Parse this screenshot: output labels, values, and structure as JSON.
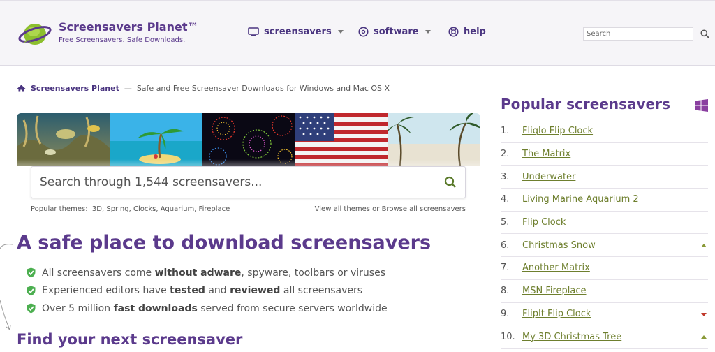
{
  "header": {
    "brand_title": "Screensavers Planet™",
    "brand_tagline": "Free Screensavers. Safe Downloads.",
    "nav": [
      {
        "label": "screensavers",
        "icon": "monitor-icon",
        "has_dropdown": true
      },
      {
        "label": "software",
        "icon": "disc-icon",
        "has_dropdown": true
      },
      {
        "label": "help",
        "icon": "lifebuoy-icon",
        "has_dropdown": false
      }
    ],
    "search_placeholder": "Search"
  },
  "breadcrumb": {
    "home": "Screensavers Planet",
    "separator": "—",
    "description": "Safe and Free Screensaver Downloads for Windows and Mac OS X"
  },
  "hero": {
    "tiles": [
      "aquarium",
      "island",
      "fireworks",
      "us-flag",
      "beach"
    ],
    "search_placeholder": "Search through 1,544 screensavers...",
    "popular_themes_label": "Popular themes:",
    "themes": [
      "3D",
      "Spring",
      "Clocks",
      "Aquarium",
      "Fireplace"
    ],
    "view_all_themes": "View all themes",
    "or_text": "or",
    "browse_all": "Browse all screensavers"
  },
  "main": {
    "heading": "A safe place to download screensavers",
    "benefits": [
      {
        "pre": "All screensavers come ",
        "bold": "without adware",
        "post": ", spyware, toolbars or viruses"
      },
      {
        "pre": "Experienced editors have ",
        "bold": "tested",
        "mid": " and ",
        "bold2": "reviewed",
        "post": " all screensavers"
      },
      {
        "pre": "Over 5 million ",
        "bold": "fast downloads",
        "post": " served from secure servers worldwide"
      }
    ],
    "subheading": "Find your next screensaver"
  },
  "sidebar": {
    "title": "Popular screensavers",
    "items": [
      {
        "num": "1.",
        "name": "Fliqlo Flip Clock",
        "trend": ""
      },
      {
        "num": "2.",
        "name": "The Matrix",
        "trend": ""
      },
      {
        "num": "3.",
        "name": "Underwater",
        "trend": ""
      },
      {
        "num": "4.",
        "name": "Living Marine Aquarium 2",
        "trend": ""
      },
      {
        "num": "5.",
        "name": "Flip Clock",
        "trend": ""
      },
      {
        "num": "6.",
        "name": "Christmas Snow",
        "trend": "up"
      },
      {
        "num": "7.",
        "name": "Another Matrix",
        "trend": ""
      },
      {
        "num": "8.",
        "name": "MSN Fireplace",
        "trend": ""
      },
      {
        "num": "9.",
        "name": "FlipIt Flip Clock",
        "trend": "down"
      },
      {
        "num": "10.",
        "name": "My 3D Christmas Tree",
        "trend": "up"
      }
    ]
  },
  "colors": {
    "brand_purple": "#5b3a8c",
    "link_green": "#6e7f2e",
    "check_green": "#4caf50",
    "trend_up": "#8a9a38",
    "trend_down": "#c0392b"
  }
}
